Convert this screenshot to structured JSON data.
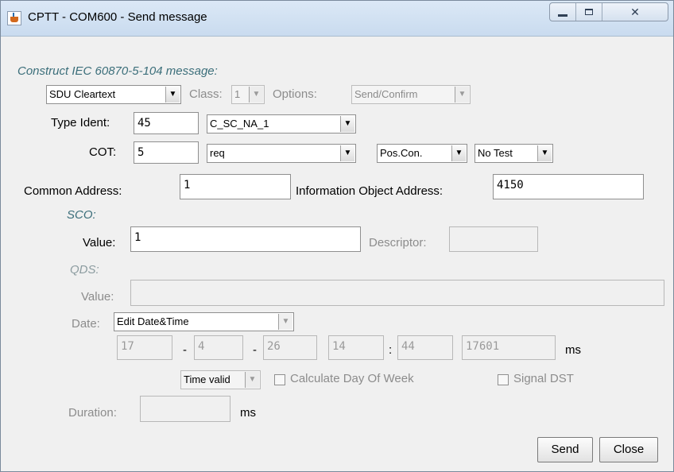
{
  "window": {
    "title": "CPTT - COM600 - Send message"
  },
  "window_controls": {
    "close_glyph": "✕"
  },
  "construct": {
    "heading": "Construct IEC 60870-5-104 message:",
    "sdu_mode": "SDU Cleartext",
    "class_label": "Class:",
    "class_value": "1",
    "options_label": "Options:",
    "options_value": "Send/Confirm"
  },
  "type_ident": {
    "label": "Type Ident:",
    "value": "45",
    "select": "C_SC_NA_1"
  },
  "cot": {
    "label": "COT:",
    "value": "5",
    "select": "req",
    "pos": "Pos.Con.",
    "test": "No Test"
  },
  "common_address": {
    "label": "Common Address:",
    "value": "1"
  },
  "ioa": {
    "label": "Information Object Address:",
    "value": "4150"
  },
  "sco": {
    "heading": "SCO:",
    "value_label": "Value:",
    "value": "1",
    "descriptor_label": "Descriptor:",
    "descriptor_value": ""
  },
  "qds": {
    "heading": "QDS:",
    "value_label": "Value:",
    "value": ""
  },
  "date": {
    "label": "Date:",
    "mode": "Edit Date&Time",
    "day": "17",
    "sep1": "-",
    "month": "4",
    "sep2": "-",
    "year": "26",
    "hour": "14",
    "colon": ":",
    "minute": "44",
    "ms": "17601",
    "ms_label": "ms",
    "validity": "Time valid",
    "calc_dow": "Calculate Day Of Week",
    "signal_dst": "Signal DST"
  },
  "duration": {
    "label": "Duration:",
    "value": "",
    "unit": "ms"
  },
  "buttons": {
    "send": "Send",
    "close": "Close"
  },
  "icons": {
    "app": "java-cup-icon",
    "dropdown": "chevron-down-icon"
  }
}
